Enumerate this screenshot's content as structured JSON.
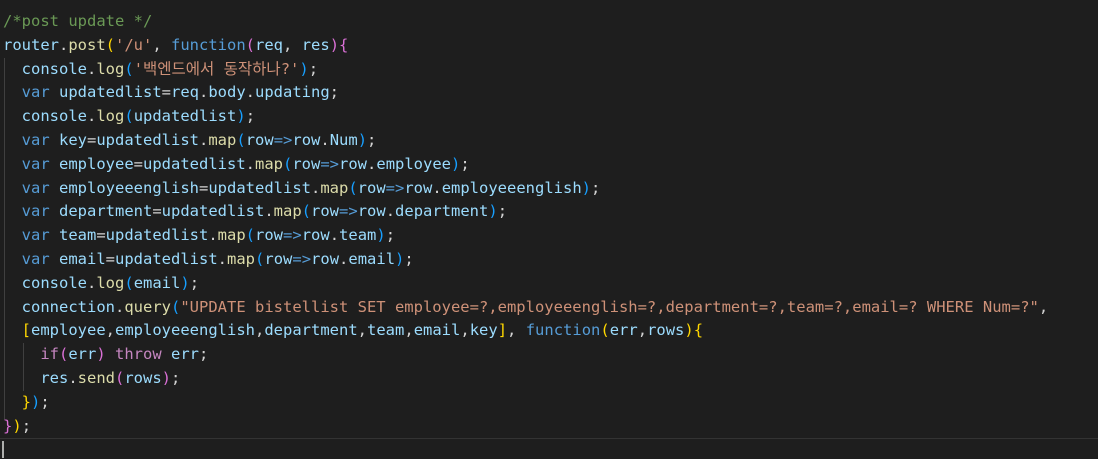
{
  "editor": {
    "language": "javascript",
    "theme_background": "#1e1e1e",
    "lines": [
      [
        {
          "t": "/*post update */",
          "c": "comment"
        }
      ],
      [
        {
          "t": "router",
          "c": "var"
        },
        {
          "t": ".",
          "c": "plain"
        },
        {
          "t": "post",
          "c": "func"
        },
        {
          "t": "(",
          "c": "brk1"
        },
        {
          "t": "'/u'",
          "c": "string"
        },
        {
          "t": ", ",
          "c": "plain"
        },
        {
          "t": "function",
          "c": "keyword"
        },
        {
          "t": "(",
          "c": "brk2"
        },
        {
          "t": "req",
          "c": "var"
        },
        {
          "t": ", ",
          "c": "plain"
        },
        {
          "t": "res",
          "c": "var"
        },
        {
          "t": ")",
          "c": "brk2"
        },
        {
          "t": "{",
          "c": "brk2"
        }
      ],
      [
        {
          "t": "  console",
          "c": "var"
        },
        {
          "t": ".",
          "c": "plain"
        },
        {
          "t": "log",
          "c": "func"
        },
        {
          "t": "(",
          "c": "brk3"
        },
        {
          "t": "'백엔드에서 동작하나?'",
          "c": "string"
        },
        {
          "t": ")",
          "c": "brk3"
        },
        {
          "t": ";",
          "c": "plain"
        }
      ],
      [
        {
          "t": "  var ",
          "c": "keyword"
        },
        {
          "t": "updatedlist",
          "c": "var"
        },
        {
          "t": "=",
          "c": "plain"
        },
        {
          "t": "req",
          "c": "var"
        },
        {
          "t": ".",
          "c": "plain"
        },
        {
          "t": "body",
          "c": "var"
        },
        {
          "t": ".",
          "c": "plain"
        },
        {
          "t": "updating",
          "c": "var"
        },
        {
          "t": ";",
          "c": "plain"
        }
      ],
      [
        {
          "t": "  console",
          "c": "var"
        },
        {
          "t": ".",
          "c": "plain"
        },
        {
          "t": "log",
          "c": "func"
        },
        {
          "t": "(",
          "c": "brk3"
        },
        {
          "t": "updatedlist",
          "c": "var"
        },
        {
          "t": ")",
          "c": "brk3"
        },
        {
          "t": ";",
          "c": "plain"
        }
      ],
      [
        {
          "t": "  var ",
          "c": "keyword"
        },
        {
          "t": "key",
          "c": "var"
        },
        {
          "t": "=",
          "c": "plain"
        },
        {
          "t": "updatedlist",
          "c": "var"
        },
        {
          "t": ".",
          "c": "plain"
        },
        {
          "t": "map",
          "c": "func"
        },
        {
          "t": "(",
          "c": "brk3"
        },
        {
          "t": "row",
          "c": "var"
        },
        {
          "t": "=>",
          "c": "keyword"
        },
        {
          "t": "row",
          "c": "var"
        },
        {
          "t": ".",
          "c": "plain"
        },
        {
          "t": "Num",
          "c": "var"
        },
        {
          "t": ")",
          "c": "brk3"
        },
        {
          "t": ";",
          "c": "plain"
        }
      ],
      [
        {
          "t": "  var ",
          "c": "keyword"
        },
        {
          "t": "employee",
          "c": "var"
        },
        {
          "t": "=",
          "c": "plain"
        },
        {
          "t": "updatedlist",
          "c": "var"
        },
        {
          "t": ".",
          "c": "plain"
        },
        {
          "t": "map",
          "c": "func"
        },
        {
          "t": "(",
          "c": "brk3"
        },
        {
          "t": "row",
          "c": "var"
        },
        {
          "t": "=>",
          "c": "keyword"
        },
        {
          "t": "row",
          "c": "var"
        },
        {
          "t": ".",
          "c": "plain"
        },
        {
          "t": "employee",
          "c": "var"
        },
        {
          "t": ")",
          "c": "brk3"
        },
        {
          "t": ";",
          "c": "plain"
        }
      ],
      [
        {
          "t": "  var ",
          "c": "keyword"
        },
        {
          "t": "employeeenglish",
          "c": "var"
        },
        {
          "t": "=",
          "c": "plain"
        },
        {
          "t": "updatedlist",
          "c": "var"
        },
        {
          "t": ".",
          "c": "plain"
        },
        {
          "t": "map",
          "c": "func"
        },
        {
          "t": "(",
          "c": "brk3"
        },
        {
          "t": "row",
          "c": "var"
        },
        {
          "t": "=>",
          "c": "keyword"
        },
        {
          "t": "row",
          "c": "var"
        },
        {
          "t": ".",
          "c": "plain"
        },
        {
          "t": "employeeenglish",
          "c": "var"
        },
        {
          "t": ")",
          "c": "brk3"
        },
        {
          "t": ";",
          "c": "plain"
        }
      ],
      [
        {
          "t": "  var ",
          "c": "keyword"
        },
        {
          "t": "department",
          "c": "var"
        },
        {
          "t": "=",
          "c": "plain"
        },
        {
          "t": "updatedlist",
          "c": "var"
        },
        {
          "t": ".",
          "c": "plain"
        },
        {
          "t": "map",
          "c": "func"
        },
        {
          "t": "(",
          "c": "brk3"
        },
        {
          "t": "row",
          "c": "var"
        },
        {
          "t": "=>",
          "c": "keyword"
        },
        {
          "t": "row",
          "c": "var"
        },
        {
          "t": ".",
          "c": "plain"
        },
        {
          "t": "department",
          "c": "var"
        },
        {
          "t": ")",
          "c": "brk3"
        },
        {
          "t": ";",
          "c": "plain"
        }
      ],
      [
        {
          "t": "  var ",
          "c": "keyword"
        },
        {
          "t": "team",
          "c": "var"
        },
        {
          "t": "=",
          "c": "plain"
        },
        {
          "t": "updatedlist",
          "c": "var"
        },
        {
          "t": ".",
          "c": "plain"
        },
        {
          "t": "map",
          "c": "func"
        },
        {
          "t": "(",
          "c": "brk3"
        },
        {
          "t": "row",
          "c": "var"
        },
        {
          "t": "=>",
          "c": "keyword"
        },
        {
          "t": "row",
          "c": "var"
        },
        {
          "t": ".",
          "c": "plain"
        },
        {
          "t": "team",
          "c": "var"
        },
        {
          "t": ")",
          "c": "brk3"
        },
        {
          "t": ";",
          "c": "plain"
        }
      ],
      [
        {
          "t": "  var ",
          "c": "keyword"
        },
        {
          "t": "email",
          "c": "var"
        },
        {
          "t": "=",
          "c": "plain"
        },
        {
          "t": "updatedlist",
          "c": "var"
        },
        {
          "t": ".",
          "c": "plain"
        },
        {
          "t": "map",
          "c": "func"
        },
        {
          "t": "(",
          "c": "brk3"
        },
        {
          "t": "row",
          "c": "var"
        },
        {
          "t": "=>",
          "c": "keyword"
        },
        {
          "t": "row",
          "c": "var"
        },
        {
          "t": ".",
          "c": "plain"
        },
        {
          "t": "email",
          "c": "var"
        },
        {
          "t": ")",
          "c": "brk3"
        },
        {
          "t": ";",
          "c": "plain"
        }
      ],
      [
        {
          "t": "  console",
          "c": "var"
        },
        {
          "t": ".",
          "c": "plain"
        },
        {
          "t": "log",
          "c": "func"
        },
        {
          "t": "(",
          "c": "brk3"
        },
        {
          "t": "email",
          "c": "var"
        },
        {
          "t": ")",
          "c": "brk3"
        },
        {
          "t": ";",
          "c": "plain"
        }
      ],
      [
        {
          "t": "  connection",
          "c": "var"
        },
        {
          "t": ".",
          "c": "plain"
        },
        {
          "t": "query",
          "c": "func"
        },
        {
          "t": "(",
          "c": "brk3"
        },
        {
          "t": "\"UPDATE bistellist SET employee=?,employeeenglish=?,department=?,team=?,email=? WHERE Num=?\"",
          "c": "string"
        },
        {
          "t": ",",
          "c": "plain"
        }
      ],
      [
        {
          "t": "  ",
          "c": "plain"
        },
        {
          "t": "[",
          "c": "brk1"
        },
        {
          "t": "employee",
          "c": "var"
        },
        {
          "t": ",",
          "c": "plain"
        },
        {
          "t": "employeeenglish",
          "c": "var"
        },
        {
          "t": ",",
          "c": "plain"
        },
        {
          "t": "department",
          "c": "var"
        },
        {
          "t": ",",
          "c": "plain"
        },
        {
          "t": "team",
          "c": "var"
        },
        {
          "t": ",",
          "c": "plain"
        },
        {
          "t": "email",
          "c": "var"
        },
        {
          "t": ",",
          "c": "plain"
        },
        {
          "t": "key",
          "c": "var"
        },
        {
          "t": "]",
          "c": "brk1"
        },
        {
          "t": ", ",
          "c": "plain"
        },
        {
          "t": "function",
          "c": "keyword"
        },
        {
          "t": "(",
          "c": "brk1"
        },
        {
          "t": "err",
          "c": "var"
        },
        {
          "t": ",",
          "c": "plain"
        },
        {
          "t": "rows",
          "c": "var"
        },
        {
          "t": ")",
          "c": "brk1"
        },
        {
          "t": "{",
          "c": "brk1"
        }
      ],
      [
        {
          "t": "    if",
          "c": "control"
        },
        {
          "t": "(",
          "c": "brk2"
        },
        {
          "t": "err",
          "c": "var"
        },
        {
          "t": ")",
          "c": "brk2"
        },
        {
          "t": " throw ",
          "c": "control"
        },
        {
          "t": "err",
          "c": "var"
        },
        {
          "t": ";",
          "c": "plain"
        }
      ],
      [
        {
          "t": "    res",
          "c": "var"
        },
        {
          "t": ".",
          "c": "plain"
        },
        {
          "t": "send",
          "c": "func"
        },
        {
          "t": "(",
          "c": "brk2"
        },
        {
          "t": "rows",
          "c": "var"
        },
        {
          "t": ")",
          "c": "brk2"
        },
        {
          "t": ";",
          "c": "plain"
        }
      ],
      [
        {
          "t": "  }",
          "c": "brk1"
        },
        {
          "t": ")",
          "c": "brk3"
        },
        {
          "t": ";",
          "c": "plain"
        }
      ],
      [
        {
          "t": "}",
          "c": "brk2"
        },
        {
          "t": ")",
          "c": "brk1"
        },
        {
          "t": ";",
          "c": "plain"
        }
      ]
    ]
  },
  "colors": {
    "comment": "#6a9955",
    "string": "#ce9178",
    "keyword": "#569cd6",
    "control": "#c586c0",
    "function": "#dcdcaa",
    "variable": "#9cdcfe",
    "plain": "#d4d4d4"
  }
}
